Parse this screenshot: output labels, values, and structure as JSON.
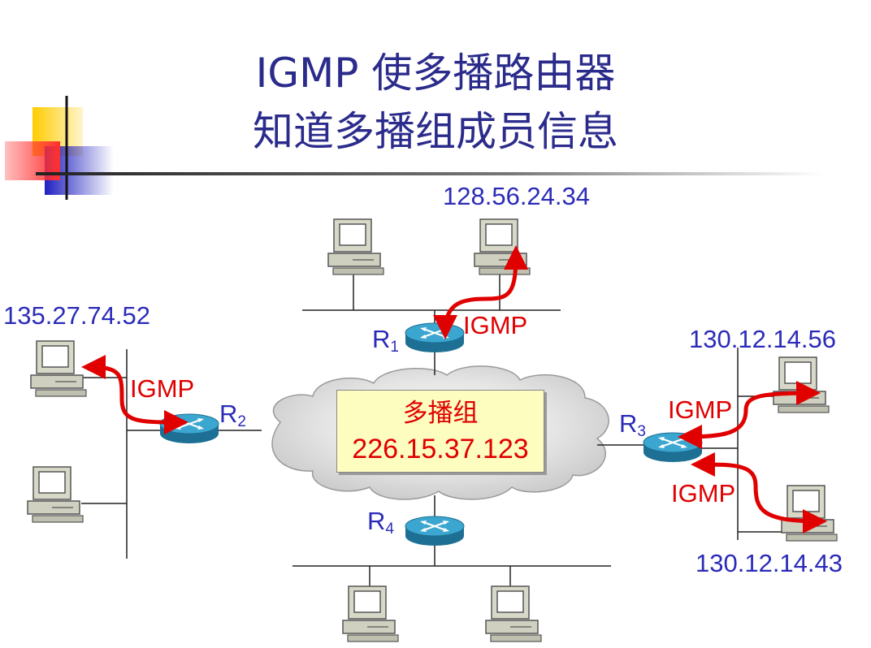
{
  "title": {
    "line1": "IGMP 使多播路由器",
    "line2": "知道多播组成员信息"
  },
  "multicast_group": {
    "name": "多播组",
    "address": "226.15.37.123"
  },
  "routers": [
    {
      "label": "R",
      "sub": "1"
    },
    {
      "label": "R",
      "sub": "2"
    },
    {
      "label": "R",
      "sub": "3"
    },
    {
      "label": "R",
      "sub": "4"
    }
  ],
  "hosts": {
    "r1_member": "128.56.24.34",
    "r2_member": "135.27.74.52",
    "r3_member_top": "130.12.14.56",
    "r3_member_bottom": "130.12.14.43"
  },
  "igmp_label": "IGMP",
  "colors": {
    "title": "#2b2b8c",
    "ip_text": "#2b2bb8",
    "igmp": "#e00000",
    "group_box": "#fdfdc0",
    "router": "#2a8fb8"
  }
}
